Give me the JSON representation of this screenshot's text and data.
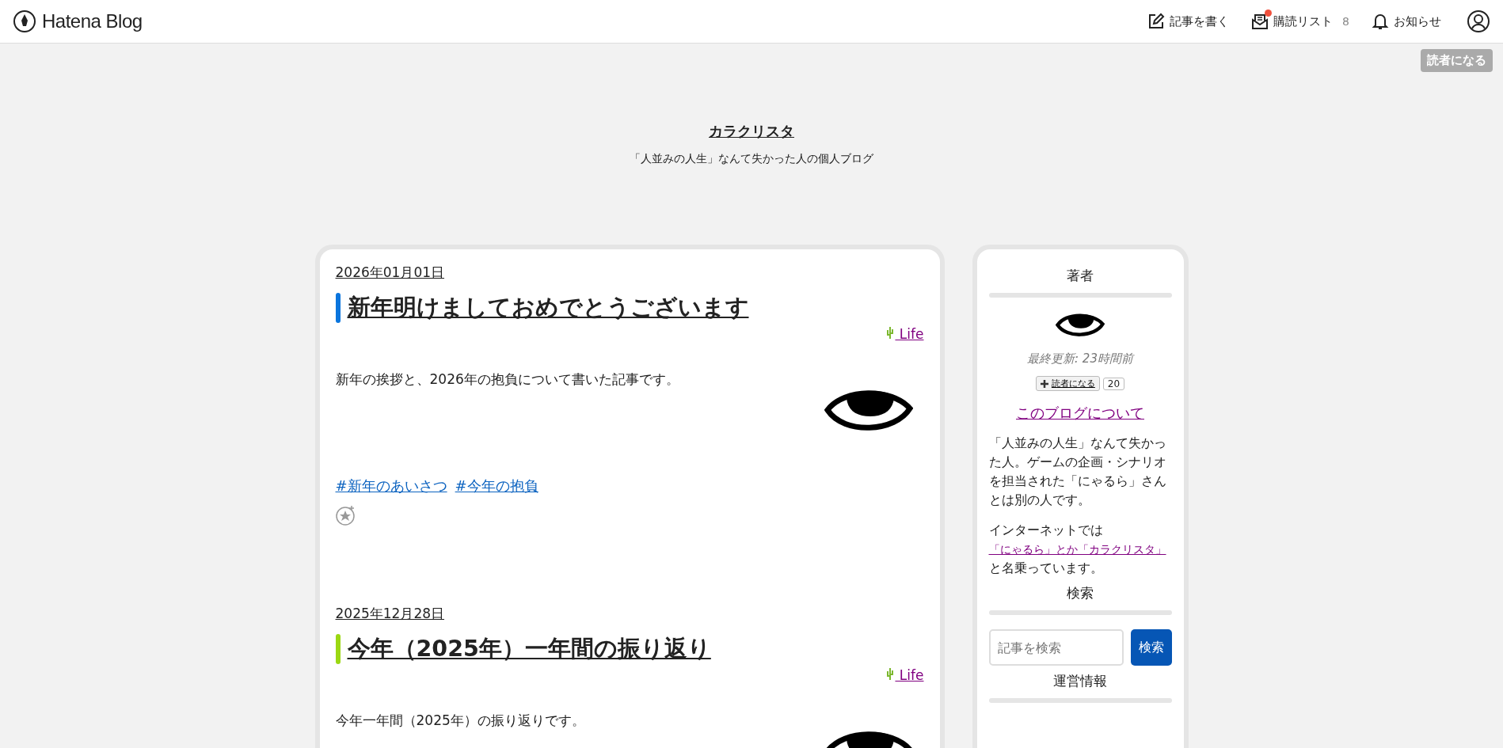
{
  "header": {
    "logo": "Hatena Blog",
    "nav": [
      {
        "kind": "edit",
        "label": "記事を書く",
        "notice": false
      },
      {
        "kind": "mail",
        "label": "購読リスト",
        "count": "8",
        "notice": true
      },
      {
        "kind": "bell",
        "label": "お知らせ",
        "notice": false
      }
    ]
  },
  "subscribe_button": "読者になる",
  "blog": {
    "title": "カラクリスタ",
    "description": "「人並みの人生」なんて失かった人の個人ブログ"
  },
  "entries": [
    {
      "date": "2026年01月01日",
      "title": "新年明けましておめでとうございます",
      "color": "#0a75dd",
      "category": "Life",
      "summary": "新年の挨拶と、2026年の抱負について書いた記事です。",
      "tags": [
        "#新年のあいさつ",
        "#今年の抱負"
      ]
    },
    {
      "date": "2025年12月28日",
      "title": "今年（2025年）一年間の振り返り",
      "color": "#9bd812",
      "category": "Life",
      "summary": "今年一年間（2025年）の振り返りです。"
    }
  ],
  "sidebar": {
    "author": {
      "heading": "著者",
      "updated": "最終更新: 23時間前",
      "subscribe_label": "読者になる",
      "subscriber_count": "20",
      "about_link": "このブログについて",
      "paragraphs": [
        {
          "text": "「人並みの人生」なんて失かった人。ゲームの企画・シナリオを担当された「にゃるら」さんとは別の人です。"
        },
        {
          "text": "インターネットでは",
          "link": "「にゃるら」とか「カラクリスタ」",
          "after": "と名乗っています。"
        }
      ]
    },
    "search": {
      "heading": "検索",
      "placeholder": "記事を検索",
      "button": "検索"
    },
    "info": {
      "heading": "運営情報"
    }
  }
}
